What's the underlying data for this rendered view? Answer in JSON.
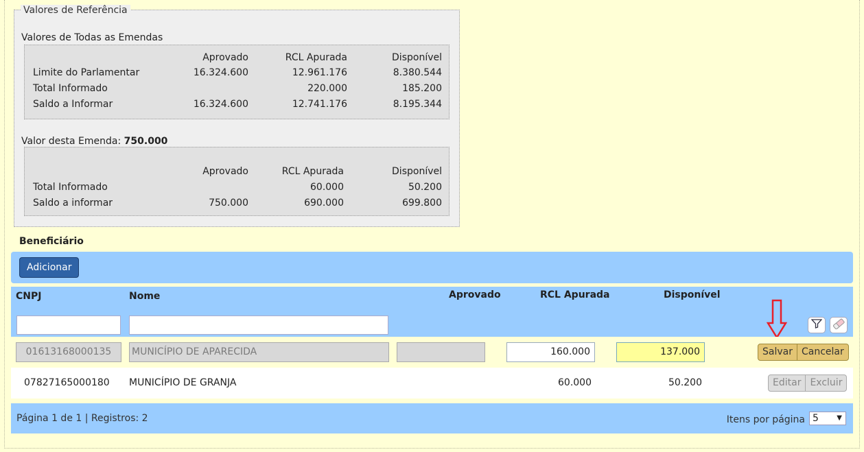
{
  "reference": {
    "legend": "Valores de Referência",
    "all_title": "Valores de Todas as Emendas",
    "headers": [
      "Aprovado",
      "RCL Apurada",
      "Disponível"
    ],
    "all_rows": [
      {
        "label": "Limite do Parlamentar",
        "aprovado": "16.324.600",
        "rcl": "12.961.176",
        "disp": "8.380.544"
      },
      {
        "label": "Total Informado",
        "aprovado": "",
        "rcl": "220.000",
        "disp": "185.200"
      },
      {
        "label": "Saldo a Informar",
        "aprovado": "16.324.600",
        "rcl": "12.741.176",
        "disp": "8.195.344"
      }
    ],
    "this_label": "Valor desta Emenda:",
    "this_value": "750.000",
    "this_rows": [
      {
        "label": "Total Informado",
        "aprovado": "",
        "rcl": "60.000",
        "disp": "50.200"
      },
      {
        "label": "Saldo a informar",
        "aprovado": "750.000",
        "rcl": "690.000",
        "disp": "699.800"
      }
    ]
  },
  "beneficiario": {
    "title": "Beneficiário",
    "add_label": "Adicionar",
    "columns": {
      "cnpj": "CNPJ",
      "nome": "Nome",
      "aprovado": "Aprovado",
      "rcl": "RCL Apurada",
      "disp": "Disponível"
    },
    "filter": {
      "cnpj": "",
      "nome": ""
    },
    "edit_row": {
      "cnpj": "01613168000135",
      "nome": "MUNICÍPIO DE APARECIDA",
      "aprovado": "",
      "rcl": "160.000",
      "disp": "137.000",
      "save_label": "Salvar",
      "cancel_label": "Cancelar"
    },
    "view_row": {
      "cnpj": "07827165000180",
      "nome": "MUNICÍPIO DE GRANJA",
      "aprovado": "",
      "rcl": "60.000",
      "disp": "50.200",
      "edit_label": "Editar",
      "delete_label": "Excluir"
    },
    "footer": {
      "pager": "Página 1 de 1 | Registros: 2",
      "per_page_label": "Itens por página",
      "per_page_value": "5"
    }
  },
  "annotation": {
    "arrow_color": "#e8202a",
    "icons": [
      "filter-icon",
      "eraser-icon",
      "down-arrow-annotation"
    ]
  }
}
